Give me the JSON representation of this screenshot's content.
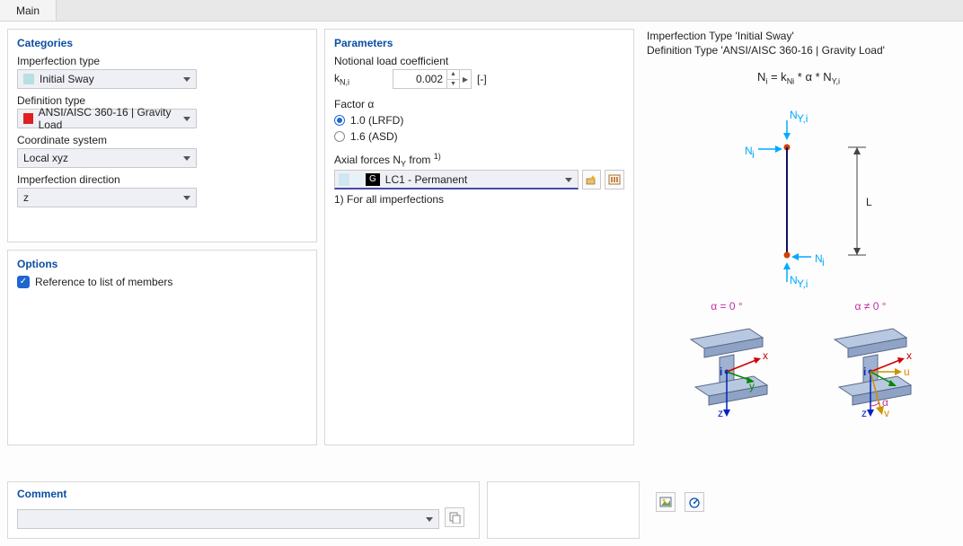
{
  "tabs": {
    "main": "Main"
  },
  "categories": {
    "title": "Categories",
    "imperfection_type_label": "Imperfection type",
    "imperfection_type_value": "Initial Sway",
    "definition_type_label": "Definition type",
    "definition_type_value": "ANSI/AISC 360-16 | Gravity Load",
    "coordinate_system_label": "Coordinate system",
    "coordinate_system_value": "Local xyz",
    "imperfection_direction_label": "Imperfection direction",
    "imperfection_direction_value": "z"
  },
  "options": {
    "title": "Options",
    "reference_checked": true,
    "reference_label": "Reference to list of members"
  },
  "parameters": {
    "title": "Parameters",
    "notional_label": "Notional load coefficient",
    "k_symbol_html": "k",
    "k_sub": "N,i",
    "k_value": "0.002",
    "k_unit": "[-]",
    "factor_label": "Factor α",
    "factor_options": [
      {
        "label": "1.0 (LRFD)",
        "checked": true
      },
      {
        "label": "1.6 (ASD)",
        "checked": false
      }
    ],
    "axial_label_pre": "Axial forces N",
    "axial_label_sub": "Y",
    "axial_label_post": " from",
    "axial_footref": "1)",
    "axial_value": "LC1 - Permanent",
    "axial_badge": "G",
    "axial_footnote": "1) For all imperfections"
  },
  "info": {
    "line1": "Imperfection Type 'Initial Sway'",
    "line2": "Definition Type 'ANSI/AISC 360-16 | Gravity Load'",
    "formula": "Nᵢ = k_Nᵢ * α * N_Y,i",
    "alpha0": "α = 0 °",
    "alphaNZ": "α ≠ 0 °"
  },
  "comment": {
    "title": "Comment",
    "value": ""
  },
  "icons": {
    "new": "new-icon",
    "library": "library-icon",
    "copy": "copy-icon",
    "img": "image-icon",
    "info": "info-icon"
  }
}
